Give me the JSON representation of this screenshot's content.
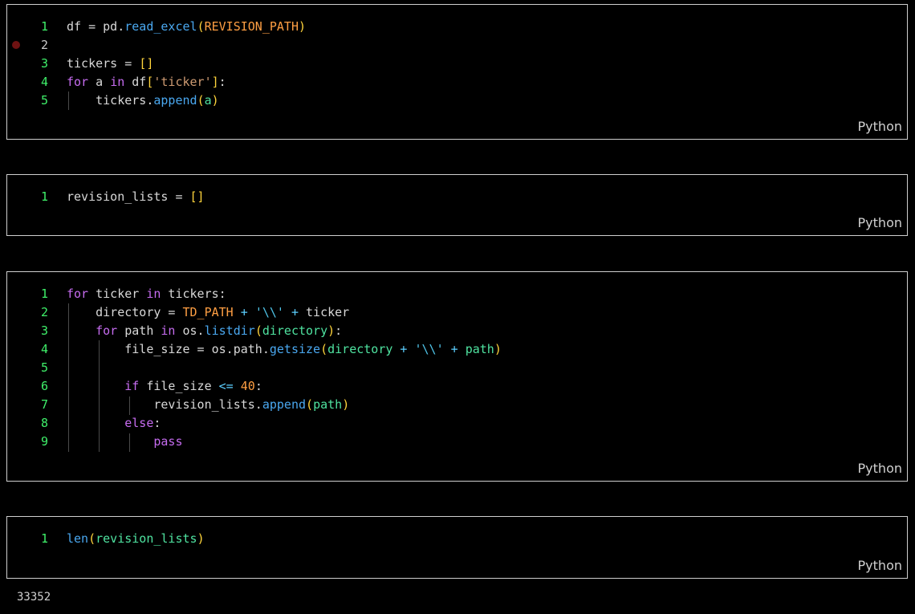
{
  "language_label": "Python",
  "colors": {
    "background": "#000000",
    "cell_border": "#cfcfcf",
    "current_line_number": "#3ff06a",
    "breakpoint": "#6e1212"
  },
  "cells": [
    {
      "lines": [
        {
          "num": "1",
          "tokens": [
            [
              "df = pd.",
              "plain"
            ],
            [
              "read_excel",
              "fn"
            ],
            [
              "(",
              "br"
            ],
            [
              "REVISION_PATH",
              "const"
            ],
            [
              ")",
              "br"
            ]
          ]
        },
        {
          "num": "2",
          "tokens": [],
          "breakpoint": true
        },
        {
          "num": "3",
          "tokens": [
            [
              "tickers = ",
              "plain"
            ],
            [
              "[]",
              "br"
            ]
          ]
        },
        {
          "num": "4",
          "tokens": [
            [
              "for",
              "kw"
            ],
            [
              " a ",
              "plain"
            ],
            [
              "in",
              "kw"
            ],
            [
              " df",
              "plain"
            ],
            [
              "[",
              "br"
            ],
            [
              "'ticker'",
              "str"
            ],
            [
              "]",
              "br"
            ],
            [
              ":",
              "plain"
            ]
          ]
        },
        {
          "num": "5",
          "tokens": [
            [
              "    tickers.",
              "plain"
            ],
            [
              "append",
              "fn"
            ],
            [
              "(",
              "br"
            ],
            [
              "a",
              "var"
            ],
            [
              ")",
              "br"
            ]
          ]
        }
      ]
    },
    {
      "lines": [
        {
          "num": "1",
          "tokens": [
            [
              "revision_lists = ",
              "plain"
            ],
            [
              "[]",
              "br"
            ]
          ]
        }
      ]
    },
    {
      "lines": [
        {
          "num": "1",
          "tokens": [
            [
              "for",
              "kw"
            ],
            [
              " ticker ",
              "plain"
            ],
            [
              "in",
              "kw"
            ],
            [
              " tickers:",
              "plain"
            ]
          ]
        },
        {
          "num": "2",
          "tokens": [
            [
              "    directory = ",
              "plain"
            ],
            [
              "TD_PATH",
              "const"
            ],
            [
              " + ",
              "op"
            ],
            [
              "'\\\\'",
              "esc"
            ],
            [
              " + ",
              "op"
            ],
            [
              "ticker",
              "plain"
            ]
          ]
        },
        {
          "num": "3",
          "tokens": [
            [
              "    ",
              "plain"
            ],
            [
              "for",
              "kw"
            ],
            [
              " path ",
              "plain"
            ],
            [
              "in",
              "kw"
            ],
            [
              " os.",
              "plain"
            ],
            [
              "listdir",
              "fn"
            ],
            [
              "(",
              "br"
            ],
            [
              "directory",
              "var"
            ],
            [
              ")",
              "br"
            ],
            [
              ":",
              "plain"
            ]
          ]
        },
        {
          "num": "4",
          "tokens": [
            [
              "        file_size = os.path.",
              "plain"
            ],
            [
              "getsize",
              "fn"
            ],
            [
              "(",
              "br"
            ],
            [
              "directory",
              "var"
            ],
            [
              " + ",
              "op"
            ],
            [
              "'\\\\'",
              "esc"
            ],
            [
              " + ",
              "op"
            ],
            [
              "path",
              "var"
            ],
            [
              ")",
              "br"
            ]
          ]
        },
        {
          "num": "5",
          "tokens": []
        },
        {
          "num": "6",
          "tokens": [
            [
              "        ",
              "plain"
            ],
            [
              "if",
              "kw"
            ],
            [
              " file_size ",
              "plain"
            ],
            [
              "<=",
              "op"
            ],
            [
              " ",
              "plain"
            ],
            [
              "40",
              "num"
            ],
            [
              ":",
              "plain"
            ]
          ]
        },
        {
          "num": "7",
          "tokens": [
            [
              "            revision_lists.",
              "plain"
            ],
            [
              "append",
              "fn"
            ],
            [
              "(",
              "br"
            ],
            [
              "path",
              "var"
            ],
            [
              ")",
              "br"
            ]
          ]
        },
        {
          "num": "8",
          "tokens": [
            [
              "        ",
              "plain"
            ],
            [
              "else",
              "kw"
            ],
            [
              ":",
              "plain"
            ]
          ]
        },
        {
          "num": "9",
          "tokens": [
            [
              "            ",
              "plain"
            ],
            [
              "pass",
              "kw"
            ]
          ]
        }
      ]
    },
    {
      "lines": [
        {
          "num": "1",
          "tokens": [
            [
              "len",
              "fn"
            ],
            [
              "(",
              "br"
            ],
            [
              "revision_lists",
              "var"
            ],
            [
              ")",
              "br"
            ]
          ]
        }
      ]
    }
  ],
  "output": "33352"
}
